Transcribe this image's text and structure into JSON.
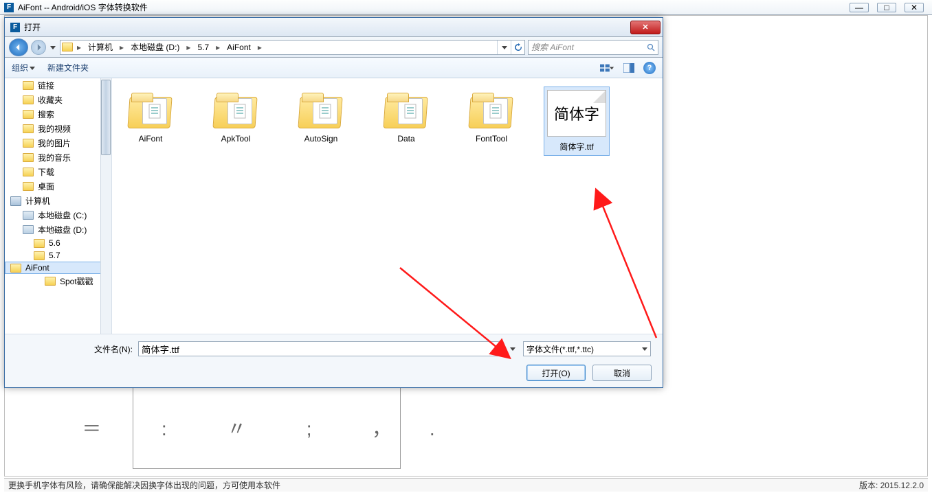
{
  "app": {
    "title": "AiFont -- Android/iOS 字体转换软件",
    "icon_letter": "F"
  },
  "window_controls": {
    "min_glyph": "—",
    "max_glyph": "□",
    "close_glyph": "✕"
  },
  "statusbar": {
    "left": "更换手机字体有风险，请确保能解决因换字体出现的问题，方可使用本软件",
    "right": "版本: 2015.12.2.0"
  },
  "preview_text": "＝  :  〃  ;  ， .",
  "dialog": {
    "title": "打开",
    "close_glyph": "✕",
    "breadcrumb": [
      "计算机",
      "本地磁盘 (D:)",
      "5.7",
      "AiFont"
    ],
    "search_placeholder": "搜索 AiFont",
    "toolbar": {
      "organize": "组织",
      "new_folder": "新建文件夹"
    },
    "tree": [
      {
        "label": "链接",
        "icon": "fold",
        "indent": 1
      },
      {
        "label": "收藏夹",
        "icon": "fold",
        "indent": 1
      },
      {
        "label": "搜索",
        "icon": "fold",
        "indent": 1
      },
      {
        "label": "我的视频",
        "icon": "fold",
        "indent": 1
      },
      {
        "label": "我的图片",
        "icon": "fold",
        "indent": 1
      },
      {
        "label": "我的音乐",
        "icon": "fold",
        "indent": 1
      },
      {
        "label": "下载",
        "icon": "fold",
        "indent": 1
      },
      {
        "label": "桌面",
        "icon": "fold",
        "indent": 1
      },
      {
        "label": "计算机",
        "icon": "comp",
        "indent": 0
      },
      {
        "label": "本地磁盘 (C:)",
        "icon": "drive",
        "indent": 1
      },
      {
        "label": "本地磁盘 (D:)",
        "icon": "drive",
        "indent": 1
      },
      {
        "label": "5.6",
        "icon": "fold",
        "indent": 2
      },
      {
        "label": "5.7",
        "icon": "fold",
        "indent": 2
      },
      {
        "label": "AiFont",
        "icon": "fold",
        "indent": 3,
        "selected": true
      },
      {
        "label": "Spot戳戳",
        "icon": "fold",
        "indent": 3
      }
    ],
    "files": [
      {
        "name": "AiFont",
        "type": "folder"
      },
      {
        "name": "ApkTool",
        "type": "folder"
      },
      {
        "name": "AutoSign",
        "type": "folder"
      },
      {
        "name": "Data",
        "type": "folder"
      },
      {
        "name": "FontTool",
        "type": "folder"
      },
      {
        "name": "简体字.ttf",
        "type": "ttf",
        "preview_text": "简体字",
        "selected": true
      }
    ],
    "filename_label": "文件名(N):",
    "filename_value": "简体字.ttf",
    "filter_value": "字体文件(*.ttf,*.ttc)",
    "open_btn": "打开(O)",
    "cancel_btn": "取消"
  }
}
